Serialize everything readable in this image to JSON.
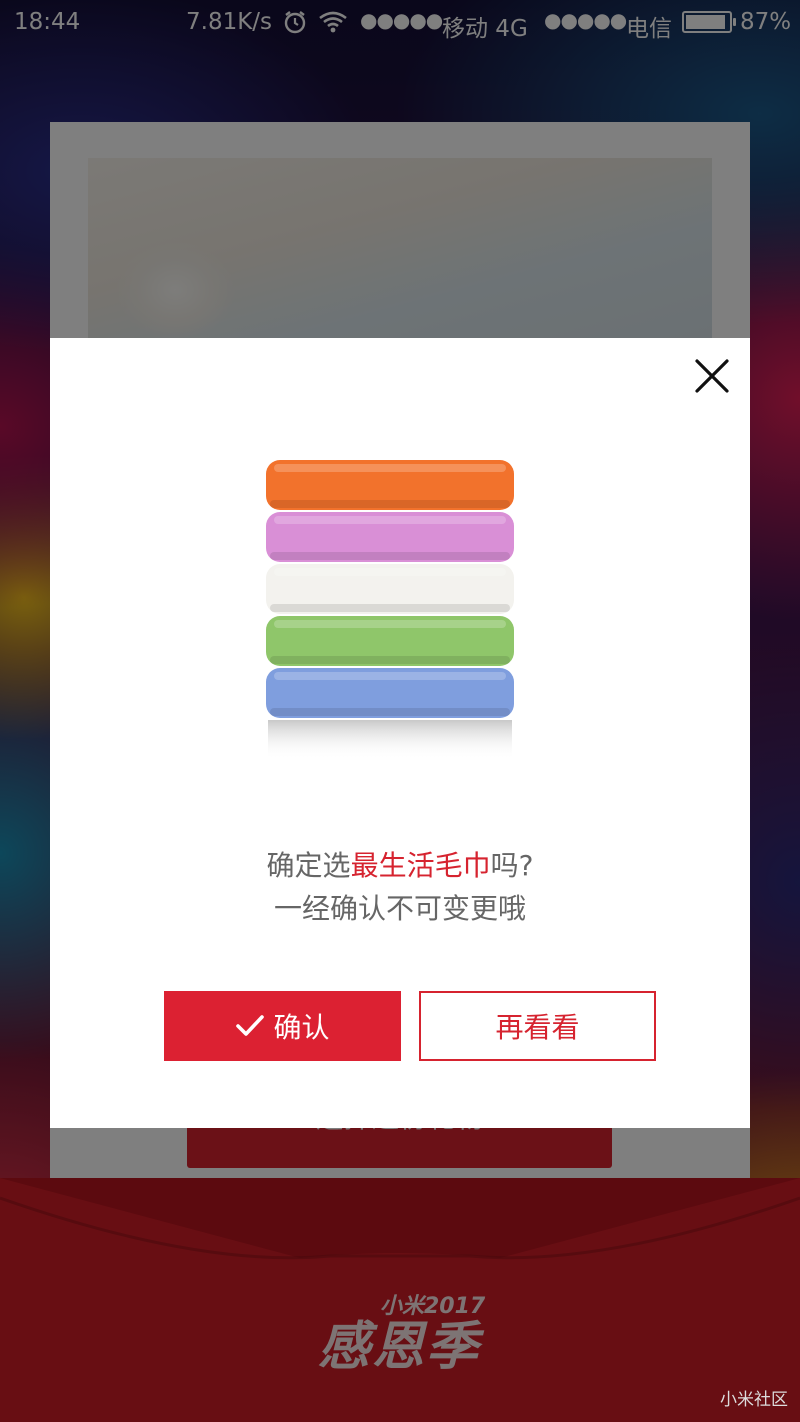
{
  "status_bar": {
    "time": "18:44",
    "net_speed": "7.81K/s",
    "signal_dots_1": "●●●●●",
    "carrier_1": "移动 4G",
    "signal_dots_2": "●●●●●",
    "carrier_2": "电信",
    "battery_pct": "87%"
  },
  "background": {
    "card_button_label": "选择这份礼物",
    "event_logo_sub": "小米2017",
    "event_logo_main": "感恩季",
    "watermark": "小米社区"
  },
  "modal": {
    "message_prefix": "确定选",
    "product_name": "最生活毛巾",
    "message_suffix": "吗?",
    "message_line2": "一经确认不可变更哦",
    "confirm_label": "确认",
    "reconsider_label": "再看看",
    "accent_color": "#dc2132"
  },
  "product": {
    "towel_colors": [
      "#f2722c",
      "#d98fd6",
      "#f3f2ee",
      "#8fc66a",
      "#7f9ede"
    ]
  }
}
